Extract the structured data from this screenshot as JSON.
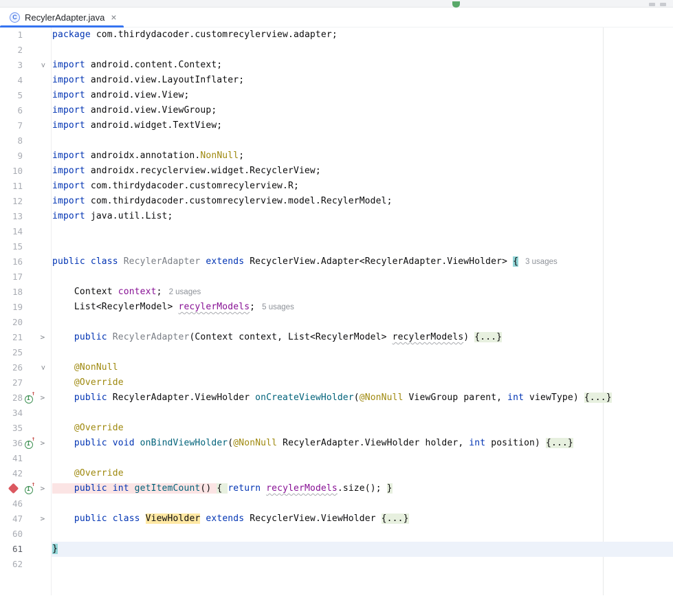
{
  "toolbar": {
    "run_icon": "run-button-partial",
    "window_icons": [
      "toolbar-icon-left",
      "toolbar-icon-right"
    ]
  },
  "tabs": [
    {
      "label": "RecylerAdapter.java",
      "icon": "java-class-icon",
      "icon_letter": "C",
      "close": "×",
      "active": true
    }
  ],
  "colors": {
    "accent": "#3574F0",
    "keyword": "#0033B3",
    "method": "#00627A",
    "annotation": "#9E880D",
    "field": "#871094",
    "class_name": "#7A7E85",
    "breakpoint": "#DB5860",
    "breakpoint_line_bg": "#FBE4E4",
    "folded_region_bg": "#E7F0DF",
    "matched_brace_bg": "#93D6D8",
    "identifier_highlight_bg": "#FFE8A3",
    "current_line_bg": "#EDF2FA"
  },
  "editor": {
    "lines": [
      {
        "n": "1",
        "tokens": [
          {
            "s": "k",
            "t": "package "
          },
          {
            "s": "t",
            "t": "com.thirdydacoder.customrecylerview.adapter;"
          }
        ]
      },
      {
        "n": "2",
        "tokens": []
      },
      {
        "n": "3",
        "fold": "down",
        "tokens": [
          {
            "s": "k",
            "t": "import "
          },
          {
            "s": "t",
            "t": "android.content.Context;"
          }
        ]
      },
      {
        "n": "4",
        "tokens": [
          {
            "s": "k",
            "t": "import "
          },
          {
            "s": "t",
            "t": "android.view.LayoutInflater;"
          }
        ]
      },
      {
        "n": "5",
        "tokens": [
          {
            "s": "k",
            "t": "import "
          },
          {
            "s": "t",
            "t": "android.view.View;"
          }
        ]
      },
      {
        "n": "6",
        "tokens": [
          {
            "s": "k",
            "t": "import "
          },
          {
            "s": "t",
            "t": "android.view.ViewGroup;"
          }
        ]
      },
      {
        "n": "7",
        "tokens": [
          {
            "s": "k",
            "t": "import "
          },
          {
            "s": "t",
            "t": "android.widget.TextView;"
          }
        ]
      },
      {
        "n": "8",
        "tokens": []
      },
      {
        "n": "9",
        "tokens": [
          {
            "s": "k",
            "t": "import "
          },
          {
            "s": "t",
            "t": "androidx.annotation."
          },
          {
            "s": "a",
            "t": "NonNull"
          },
          {
            "s": "t",
            "t": ";"
          }
        ]
      },
      {
        "n": "10",
        "tokens": [
          {
            "s": "k",
            "t": "import "
          },
          {
            "s": "t",
            "t": "androidx.recyclerview.widget.RecyclerView;"
          }
        ]
      },
      {
        "n": "11",
        "tokens": [
          {
            "s": "k",
            "t": "import "
          },
          {
            "s": "t",
            "t": "com.thirdydacoder.customrecylerview.R;"
          }
        ]
      },
      {
        "n": "12",
        "tokens": [
          {
            "s": "k",
            "t": "import "
          },
          {
            "s": "t",
            "t": "com.thirdydacoder.customrecylerview.model.RecylerModel;"
          }
        ]
      },
      {
        "n": "13",
        "tokens": [
          {
            "s": "k",
            "t": "import "
          },
          {
            "s": "t",
            "t": "java.util.List;"
          }
        ]
      },
      {
        "n": "14",
        "tokens": []
      },
      {
        "n": "15",
        "tokens": []
      },
      {
        "n": "16",
        "tokens": [
          {
            "s": "k",
            "t": "public class "
          },
          {
            "s": "c",
            "t": "RecylerAdapter "
          },
          {
            "s": "k",
            "t": "extends "
          },
          {
            "s": "t",
            "t": "RecyclerView.Adapter<RecylerAdapter.ViewHolder> "
          },
          {
            "s": "t hlteal",
            "t": "{"
          },
          {
            "s": "inlay",
            "t": "3 usages"
          }
        ]
      },
      {
        "n": "17",
        "tokens": []
      },
      {
        "n": "18",
        "tokens": [
          {
            "s": "t",
            "t": "    Context "
          },
          {
            "s": "f",
            "t": "context"
          },
          {
            "s": "t",
            "t": ";"
          },
          {
            "s": "inlay",
            "t": "2 usages"
          }
        ]
      },
      {
        "n": "19",
        "tokens": [
          {
            "s": "t",
            "t": "    List<RecylerModel> "
          },
          {
            "s": "fw",
            "t": "recylerModels"
          },
          {
            "s": "t",
            "t": ";"
          },
          {
            "s": "inlay",
            "t": "5 usages"
          }
        ]
      },
      {
        "n": "20",
        "tokens": []
      },
      {
        "n": "21",
        "fold": "right",
        "tokens": [
          {
            "s": "t",
            "t": "    "
          },
          {
            "s": "k",
            "t": "public "
          },
          {
            "s": "c",
            "t": "RecylerAdapter"
          },
          {
            "s": "t",
            "t": "(Context context, List<RecylerModel> "
          },
          {
            "s": "tw",
            "t": "recylerModels"
          },
          {
            "s": "t",
            "t": ") "
          },
          {
            "s": "t fold",
            "t": "{...}"
          }
        ]
      },
      {
        "n": "25",
        "tokens": []
      },
      {
        "n": "26",
        "fold": "down",
        "tokens": [
          {
            "s": "t",
            "t": "    "
          },
          {
            "s": "a",
            "t": "@NonNull"
          }
        ]
      },
      {
        "n": "27",
        "tokens": [
          {
            "s": "t",
            "t": "    "
          },
          {
            "s": "a",
            "t": "@Override"
          }
        ]
      },
      {
        "n": "28",
        "icon": "impl",
        "fold": "right",
        "tokens": [
          {
            "s": "t",
            "t": "    "
          },
          {
            "s": "k",
            "t": "public "
          },
          {
            "s": "t",
            "t": "RecylerAdapter.ViewHolder "
          },
          {
            "s": "m",
            "t": "onCreateViewHolder"
          },
          {
            "s": "t",
            "t": "("
          },
          {
            "s": "a",
            "t": "@NonNull"
          },
          {
            "s": "t",
            "t": " ViewGroup parent, "
          },
          {
            "s": "k",
            "t": "int"
          },
          {
            "s": "t",
            "t": " viewType) "
          },
          {
            "s": "t fold",
            "t": "{...}"
          }
        ]
      },
      {
        "n": "34",
        "tokens": []
      },
      {
        "n": "35",
        "tokens": [
          {
            "s": "t",
            "t": "    "
          },
          {
            "s": "a",
            "t": "@Override"
          }
        ]
      },
      {
        "n": "36",
        "icon": "impl",
        "fold": "right",
        "tokens": [
          {
            "s": "t",
            "t": "    "
          },
          {
            "s": "k",
            "t": "public void "
          },
          {
            "s": "m",
            "t": "onBindViewHolder"
          },
          {
            "s": "t",
            "t": "("
          },
          {
            "s": "a",
            "t": "@NonNull"
          },
          {
            "s": "t",
            "t": " RecylerAdapter.ViewHolder holder, "
          },
          {
            "s": "k",
            "t": "int"
          },
          {
            "s": "t",
            "t": " position) "
          },
          {
            "s": "t fold",
            "t": "{...}"
          }
        ]
      },
      {
        "n": "41",
        "tokens": []
      },
      {
        "n": "42",
        "tokens": [
          {
            "s": "t",
            "t": "    "
          },
          {
            "s": "a",
            "t": "@Override"
          }
        ]
      },
      {
        "n": "",
        "bp": true,
        "icon": "impl",
        "fold": "right",
        "tokens": [
          {
            "s": "t bp",
            "t": "    "
          },
          {
            "s": "k bp",
            "t": "public int "
          },
          {
            "s": "m bp",
            "t": "getItemCount"
          },
          {
            "s": "t bp",
            "t": "() "
          },
          {
            "s": "t fold",
            "t": "{ "
          },
          {
            "s": "k",
            "t": "return "
          },
          {
            "s": "fw",
            "t": "recylerModels"
          },
          {
            "s": "t",
            "t": ".size(); "
          },
          {
            "s": "t fold",
            "t": "}"
          }
        ]
      },
      {
        "n": "46",
        "tokens": []
      },
      {
        "n": "47",
        "fold": "right",
        "tokens": [
          {
            "s": "t",
            "t": "    "
          },
          {
            "s": "k",
            "t": "public class "
          },
          {
            "s": "t hly",
            "t": "ViewHolder"
          },
          {
            "s": "t",
            "t": " "
          },
          {
            "s": "k",
            "t": "extends "
          },
          {
            "s": "t",
            "t": "RecyclerView.ViewHolder "
          },
          {
            "s": "t fold",
            "t": "{...}"
          }
        ]
      },
      {
        "n": "60",
        "tokens": []
      },
      {
        "n": "61",
        "cur": true,
        "tokens": [
          {
            "s": "t hlteal",
            "t": "}"
          }
        ]
      },
      {
        "n": "62",
        "tokens": []
      }
    ]
  }
}
